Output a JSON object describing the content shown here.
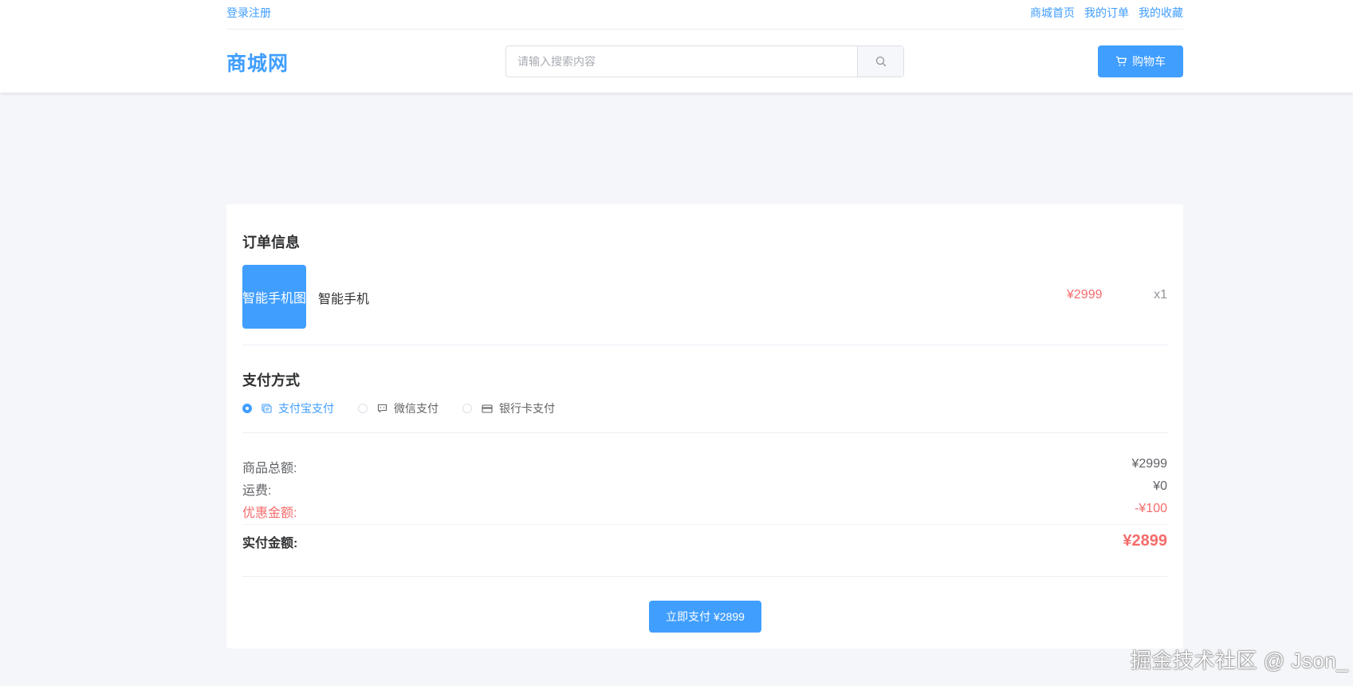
{
  "topbar": {
    "login_link": "登录注册",
    "nav": [
      "商城首页",
      "我的订单",
      "我的收藏"
    ]
  },
  "header": {
    "logo": "商城网",
    "search_placeholder": "请输入搜索内容",
    "search_icon": "search-icon",
    "cart_label": "购物车",
    "cart_icon": "shopping-cart-icon"
  },
  "order": {
    "title": "订单信息",
    "product": {
      "image_alt": "智能手机图",
      "name": "智能手机",
      "price": "¥2999",
      "qty": "x1"
    }
  },
  "payment": {
    "title": "支付方式",
    "options": [
      {
        "label": "支付宝支付",
        "icon": "alipay-icon",
        "checked": true
      },
      {
        "label": "微信支付",
        "icon": "wechat-chat-icon",
        "checked": false
      },
      {
        "label": "银行卡支付",
        "icon": "credit-card-icon",
        "checked": false
      }
    ]
  },
  "summary": {
    "subtotal_label": "商品总额:",
    "subtotal_value": "¥2999",
    "shipping_label": "运费:",
    "shipping_value": "¥0",
    "discount_label": "优惠金额:",
    "discount_value": "-¥100",
    "total_label": "实付金额:",
    "total_value": "¥2899"
  },
  "pay_button": "立即支付 ¥2899",
  "watermark": "掘金技术社区 @ Json_",
  "colors": {
    "primary": "#409eff",
    "danger": "#f56c6c"
  }
}
